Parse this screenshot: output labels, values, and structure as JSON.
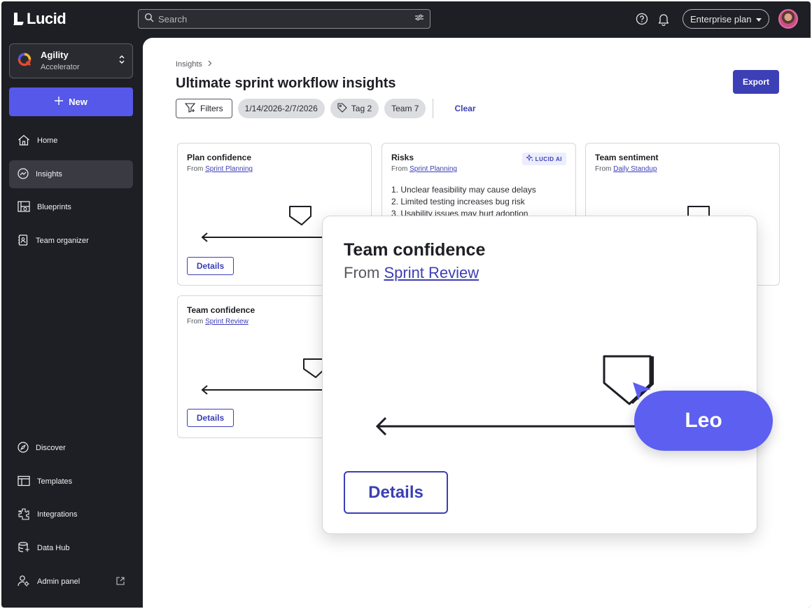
{
  "brand": {
    "name": "Lucid"
  },
  "search": {
    "placeholder": "Search"
  },
  "header": {
    "plan_label": "Enterprise plan"
  },
  "workspace": {
    "name": "Agility",
    "subtitle": "Accelerator"
  },
  "sidebar": {
    "new_label": "New",
    "items": [
      {
        "label": "Home",
        "icon": "home-icon"
      },
      {
        "label": "Insights",
        "icon": "insights-icon",
        "active": true
      },
      {
        "label": "Blueprints",
        "icon": "blueprints-icon"
      },
      {
        "label": "Team organizer",
        "icon": "team-organizer-icon"
      },
      {
        "label": "Discover",
        "icon": "compass-icon"
      },
      {
        "label": "Templates",
        "icon": "templates-icon"
      },
      {
        "label": "Integrations",
        "icon": "puzzle-icon"
      },
      {
        "label": "Data Hub",
        "icon": "database-icon"
      },
      {
        "label": "Admin panel",
        "icon": "admin-icon"
      }
    ]
  },
  "page": {
    "breadcrumb": "Insights",
    "title": "Ultimate sprint workflow insights",
    "export_label": "Export",
    "filters_label": "Filters",
    "chips": [
      "1/14/2026-2/7/2026",
      "Tag 2",
      "Team 7"
    ],
    "clear_label": "Clear"
  },
  "cards": {
    "plan_confidence": {
      "title": "Plan confidence",
      "from_prefix": "From",
      "source": "Sprint Planning",
      "details_label": "Details"
    },
    "risks": {
      "title": "Risks",
      "from_prefix": "From",
      "source": "Sprint Planning",
      "ai_label": "LUCID AI",
      "items": [
        "1. Unclear feasibility may cause delays",
        "2. Limited testing increases bug risk",
        "3. Usability issues may hurt adoption"
      ]
    },
    "team_sentiment": {
      "title": "Team sentiment",
      "from_prefix": "From",
      "source": "Daily Standup"
    },
    "team_confidence": {
      "title": "Team confidence",
      "from_prefix": "From",
      "source": "Sprint Review",
      "details_label": "Details"
    }
  },
  "zoom_card": {
    "title": "Team confidence",
    "from_prefix": "From",
    "source": "Sprint Review",
    "details_label": "Details"
  },
  "cursor": {
    "user_name": "Leo",
    "color": "#5c5ff0"
  },
  "colors": {
    "accent": "#3c3fb5",
    "new_button": "#5558e8",
    "sidebar_bg": "#1e1f24"
  }
}
